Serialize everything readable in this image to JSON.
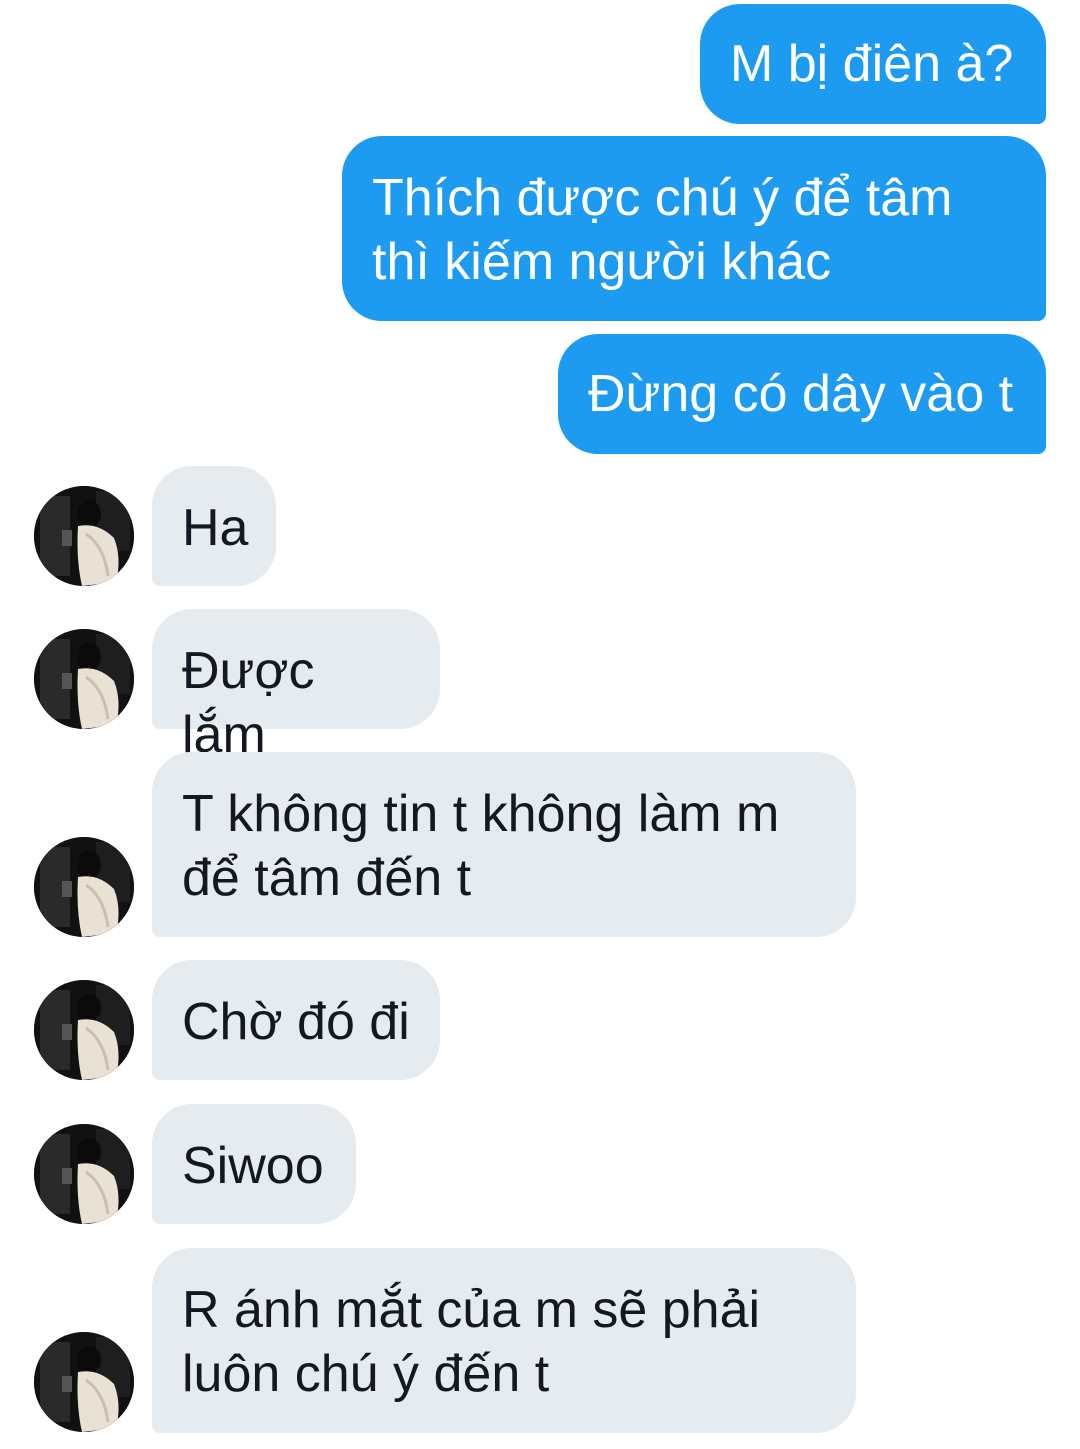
{
  "conversation": {
    "sent_messages": [
      {
        "text": "M bị điên à?"
      },
      {
        "text": "Thích được chú ý để tâm\nthì kiếm người khác"
      },
      {
        "text": "Đừng có dây vào t"
      }
    ],
    "received_messages": [
      {
        "text": "Ha"
      },
      {
        "text": "Được lắm"
      },
      {
        "text": "T không tin t không làm m\nđể tâm đến t"
      },
      {
        "text": "Chờ đó đi"
      },
      {
        "text": "Siwoo"
      },
      {
        "text": "R ánh mắt của m sẽ phải\nluôn chú ý đến t"
      }
    ],
    "colors": {
      "sent_bubble": "#1d9bf0",
      "received_bubble": "#e6ebef",
      "sent_text": "#ffffff",
      "received_text": "#141823"
    },
    "avatar_icon": "contact-photo-avatar"
  }
}
